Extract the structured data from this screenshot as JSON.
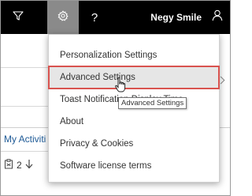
{
  "navbar": {
    "user_name": "Negy Smile",
    "help_glyph": "?",
    "icons": [
      "filter-icon",
      "gear-icon",
      "help-icon",
      "user-icon"
    ]
  },
  "menu": {
    "items": [
      {
        "label": "Personalization Settings"
      },
      {
        "label": "Advanced Settings",
        "highlighted": true
      },
      {
        "label": "Toast Notification Display Time"
      },
      {
        "label": "About"
      },
      {
        "label": "Privacy & Cookies"
      },
      {
        "label": "Software license terms"
      }
    ]
  },
  "tooltip": {
    "text": "Advanced Settings"
  },
  "background": {
    "activities_label": "My Activiti",
    "count_value": "2"
  },
  "colors": {
    "navbar_bg": "#000000",
    "gear_active_bg": "#8a8a8a",
    "highlight_border": "#d9534f",
    "link_blue": "#1e5a96"
  }
}
